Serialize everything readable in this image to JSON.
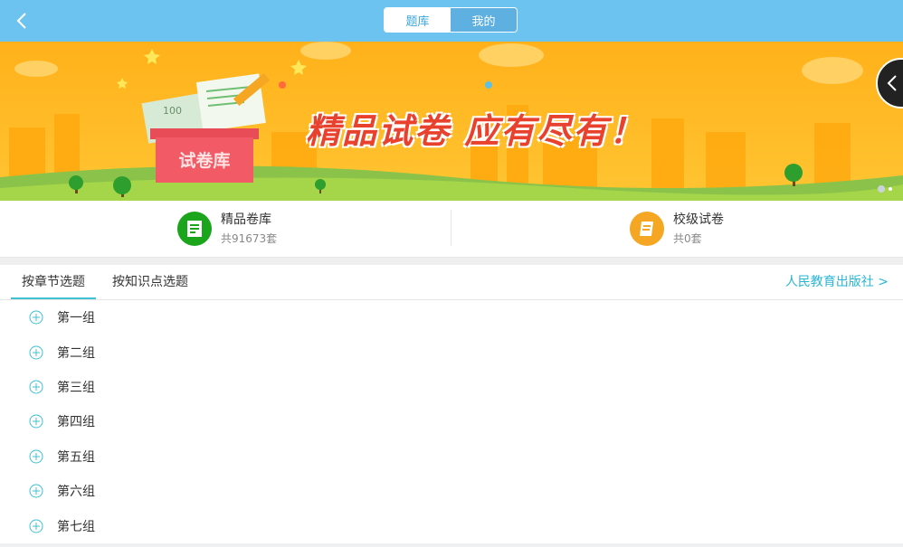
{
  "header": {
    "segment": [
      {
        "label": "题库",
        "active": true
      },
      {
        "label": "我的",
        "active": false
      }
    ],
    "colors": {
      "bar": "#6cc3f0",
      "active_text": "#3aa6de"
    }
  },
  "banner": {
    "slogan": "精品试卷 应有尽有！",
    "box_label": "试卷库",
    "paper_text": "100",
    "slide_count": 2,
    "active_slide": 1
  },
  "quick_links": [
    {
      "title": "精品卷库",
      "sub": "共91673套",
      "icon": "book-icon",
      "color": "#1aa51c"
    },
    {
      "title": "校级试卷",
      "sub": "共0套",
      "icon": "scroll-icon",
      "color": "#f5a623"
    }
  ],
  "tabs": [
    {
      "label": "按章节选题",
      "active": true
    },
    {
      "label": "按知识点选题",
      "active": false
    }
  ],
  "publisher_link": "人民教育出版社 >",
  "groups": [
    "第一组",
    "第二组",
    "第三组",
    "第四组",
    "第五组",
    "第六组",
    "第七组"
  ]
}
